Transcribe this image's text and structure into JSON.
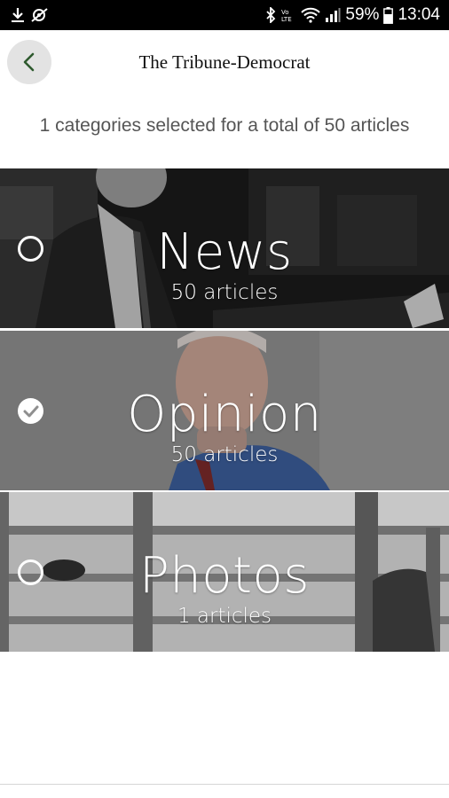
{
  "status_bar": {
    "battery": "59%",
    "time": "13:04",
    "icons": [
      "download-icon",
      "no-sound-icon",
      "bluetooth-icon",
      "volte-icon",
      "wifi-icon",
      "signal-icon",
      "battery-icon"
    ],
    "volte_label": "VoLTE"
  },
  "header": {
    "title": "The Tribune-Democrat",
    "back_icon": "chevron-left-icon"
  },
  "summary": "1 categories selected for a total of 50 articles",
  "categories": [
    {
      "name": "News",
      "count": "50 articles",
      "selected": false
    },
    {
      "name": "Opinion",
      "count": "50 articles",
      "selected": true
    },
    {
      "name": "Photos",
      "count": "1 articles",
      "selected": false
    }
  ],
  "colors": {
    "accent": "#2e5a2e",
    "status_bar": "#000000",
    "summary_text": "#555555"
  }
}
